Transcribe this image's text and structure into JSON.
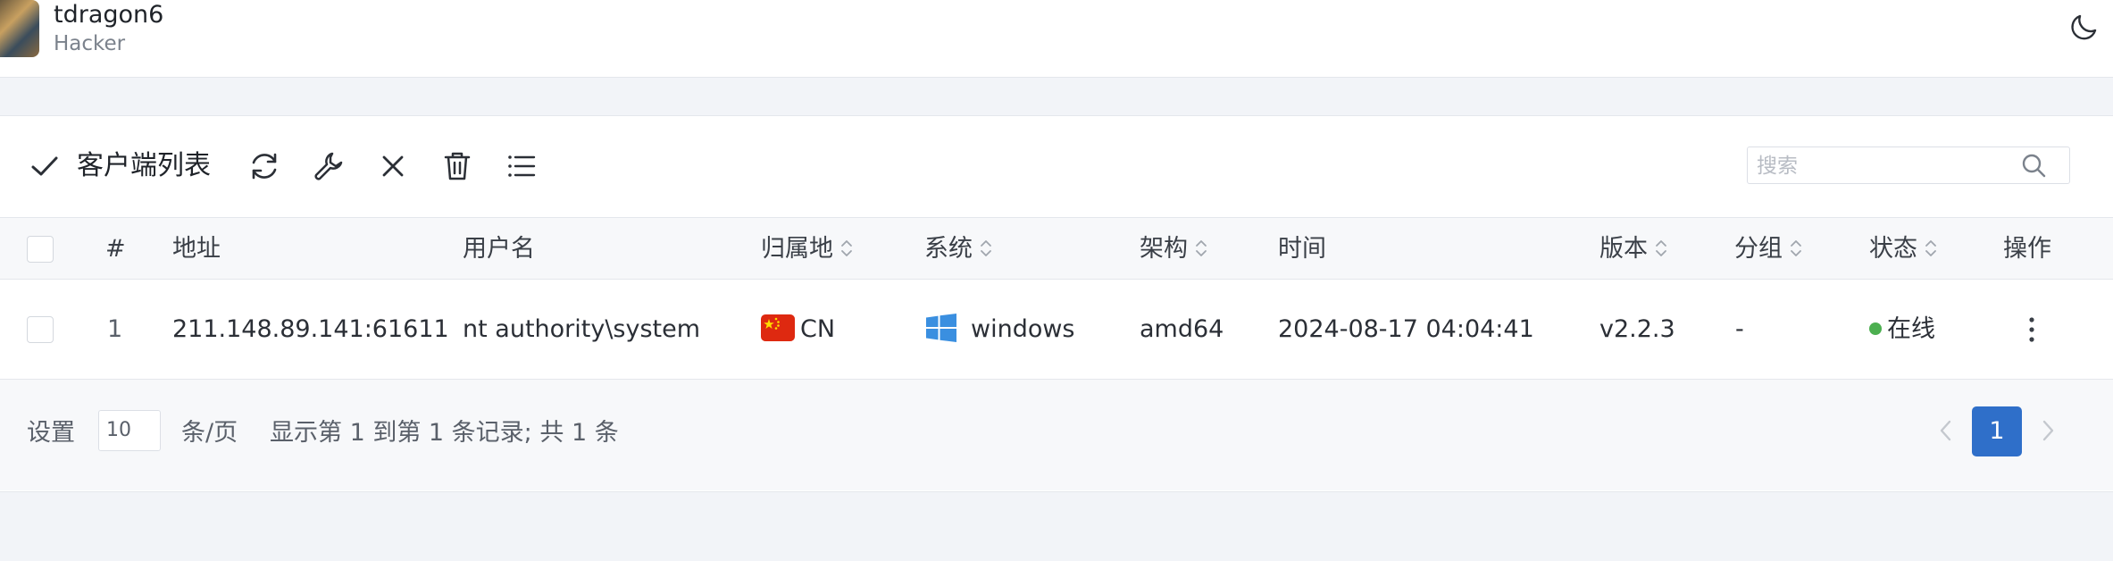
{
  "header": {
    "username": "tdragon6",
    "role": "Hacker",
    "avatar_icon": "avatar-image",
    "theme_icon": "moon-icon"
  },
  "toolbar": {
    "title": "客户端列表",
    "icons": [
      "check-icon",
      "refresh-icon",
      "wrench-icon",
      "close-icon",
      "trash-icon",
      "list-icon"
    ]
  },
  "search": {
    "placeholder": "搜索",
    "value": ""
  },
  "table": {
    "columns": {
      "index": "#",
      "address": "地址",
      "username": "用户名",
      "location": "归属地",
      "system": "系统",
      "arch": "架构",
      "time": "时间",
      "version": "版本",
      "group": "分组",
      "status": "状态",
      "actions": "操作"
    },
    "rows": [
      {
        "index": "1",
        "address": "211.148.89.141:61611",
        "username": "nt authority\\system",
        "location": "CN",
        "flag": "china-flag",
        "system": "windows",
        "system_icon": "windows-icon",
        "arch": "amd64",
        "time": "2024-08-17 04:04:41",
        "version": "v2.2.3",
        "group": "-",
        "status": "在线",
        "status_color": "#4caf50"
      }
    ]
  },
  "footer": {
    "settings_label": "设置",
    "page_size": "10",
    "per_page_label": "条/页",
    "summary": "显示第 1 到第 1 条记录; 共 1 条",
    "current_page": "1"
  },
  "colors": {
    "accent": "#2f6fc9",
    "online": "#4caf50",
    "background": "#f2f4f8"
  }
}
